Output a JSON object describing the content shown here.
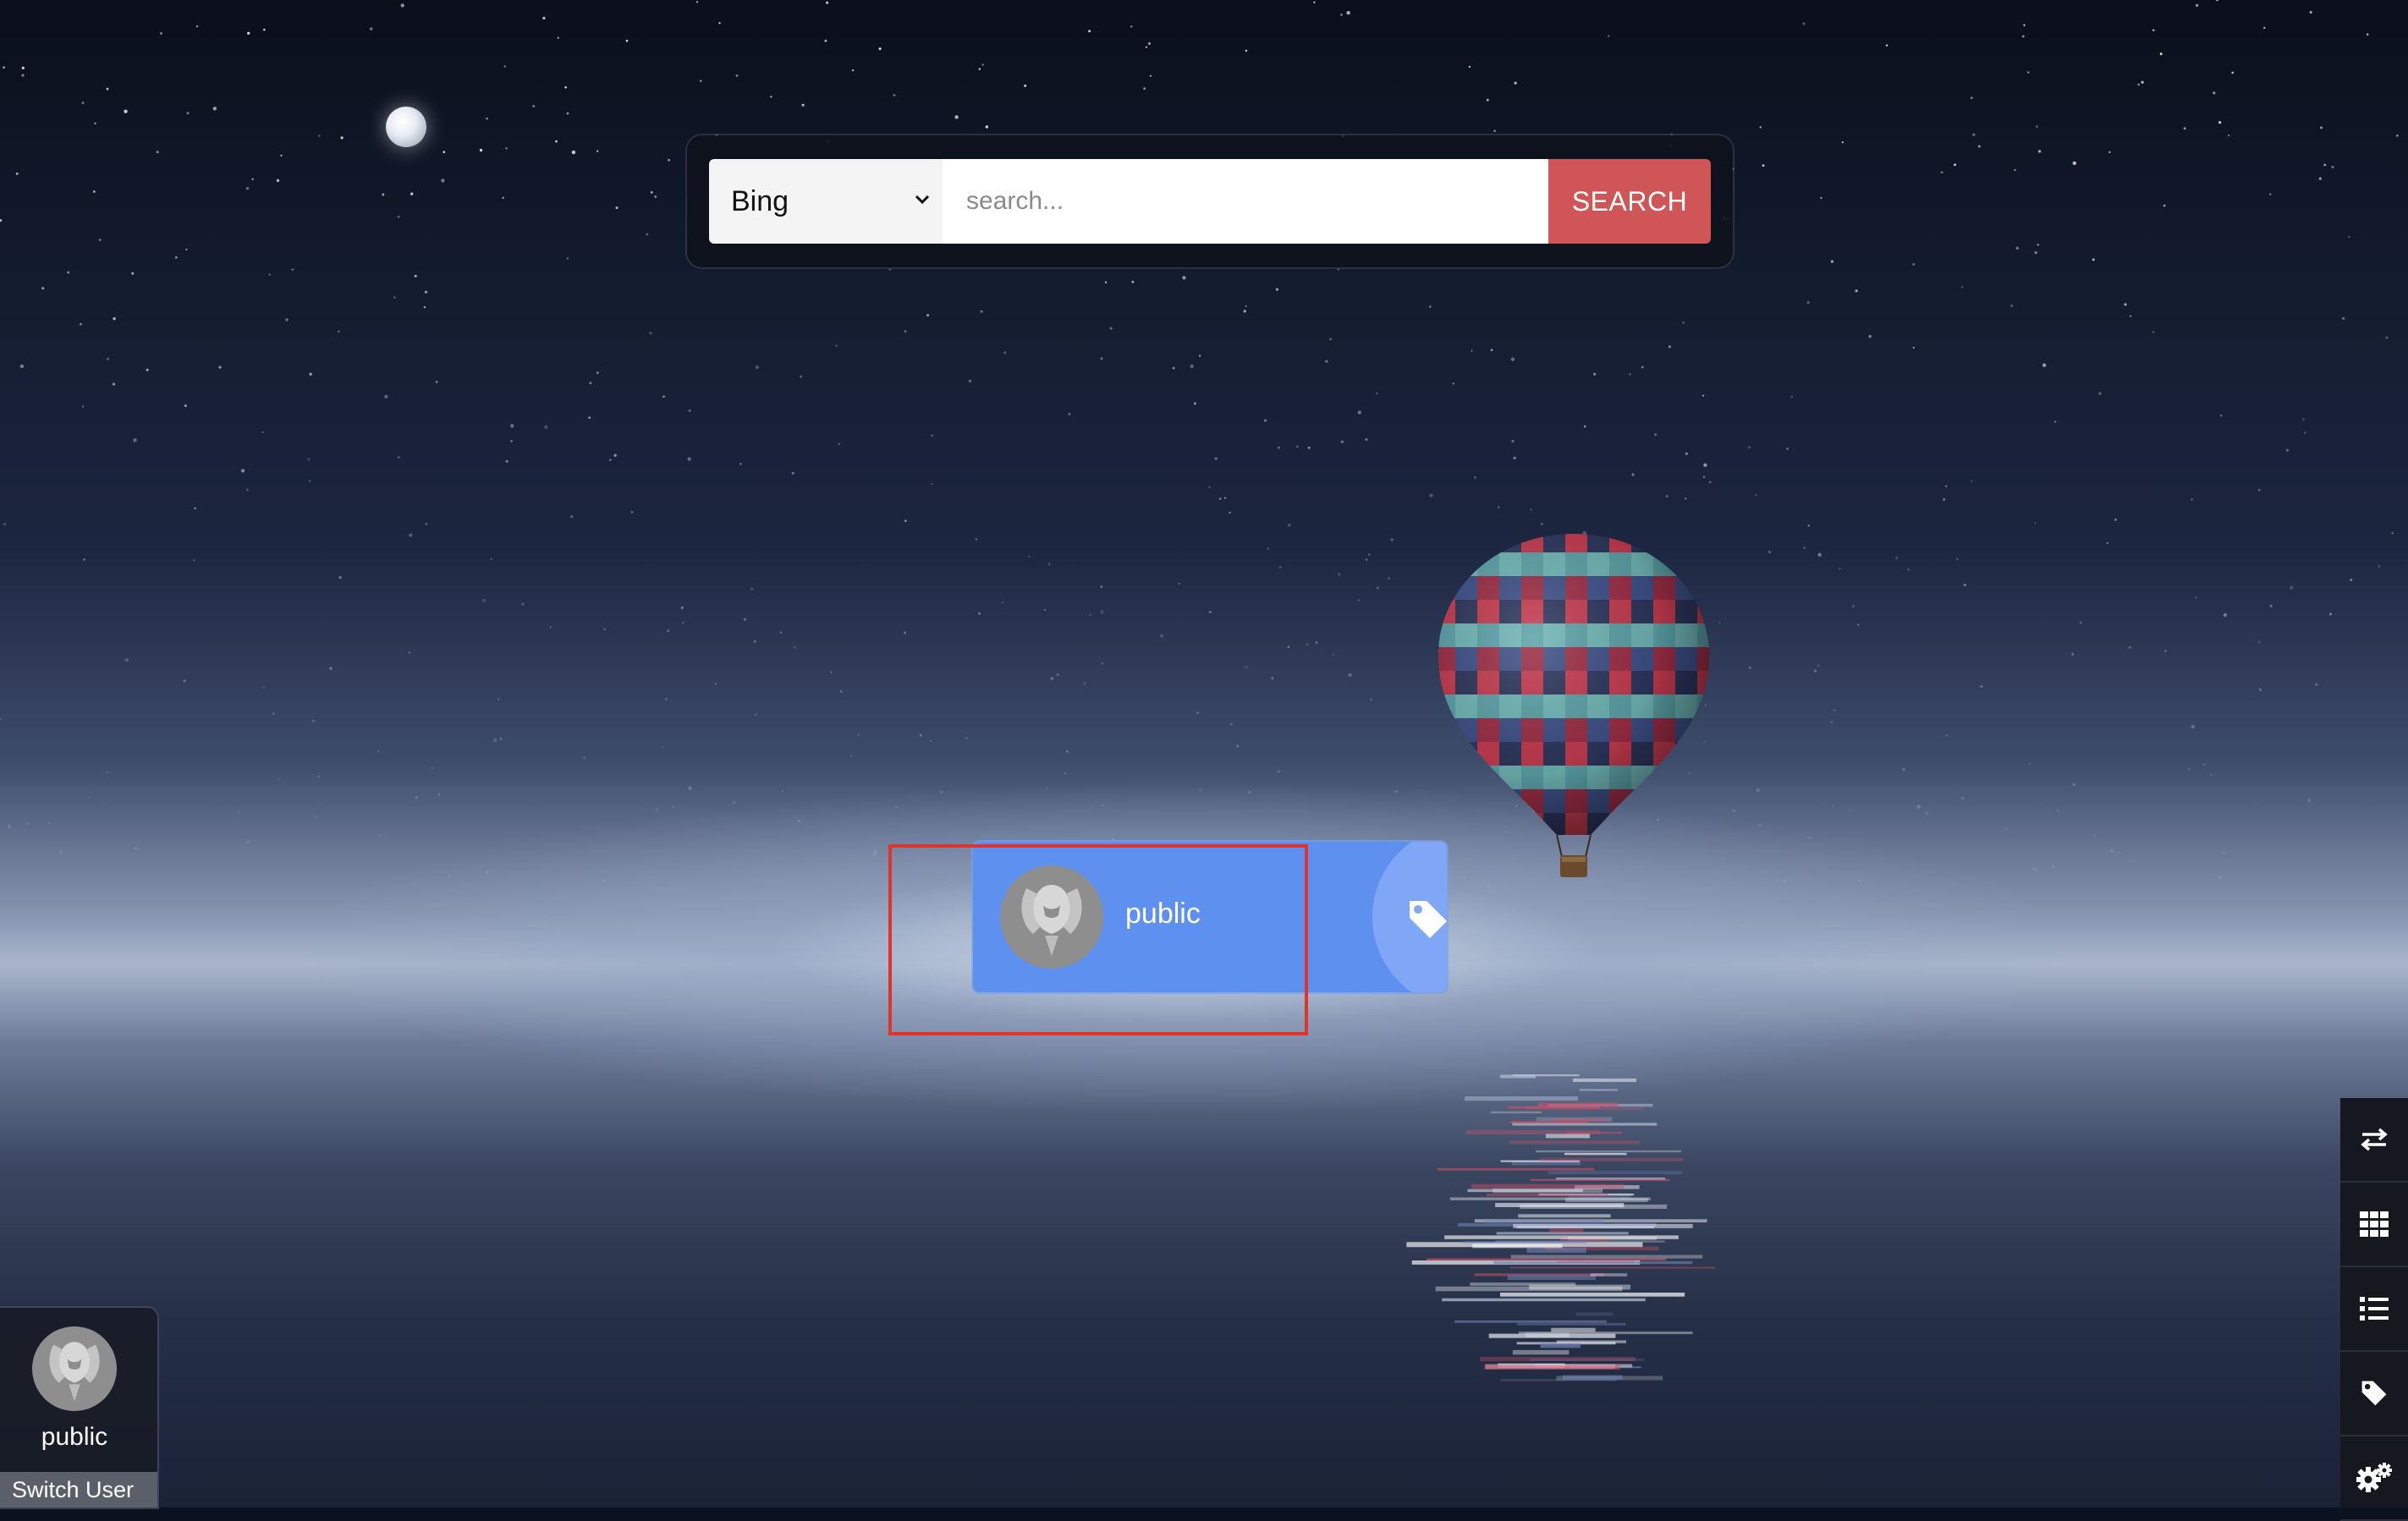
{
  "search": {
    "engine": "Bing",
    "placeholder": "search...",
    "button_label": "SEARCH"
  },
  "card": {
    "label": "public",
    "icon": "tag-icon"
  },
  "user_panel": {
    "name": "public",
    "switch_label": "Switch User"
  },
  "toolbar": {
    "items": [
      {
        "icon": "swap-icon"
      },
      {
        "icon": "grid-icon"
      },
      {
        "icon": "list-icon"
      },
      {
        "icon": "tag-icon"
      },
      {
        "icon": "gears-icon"
      }
    ]
  },
  "colors": {
    "search_button": "#cf5556",
    "card": "#5e90f0",
    "highlight": "#e0342a"
  }
}
